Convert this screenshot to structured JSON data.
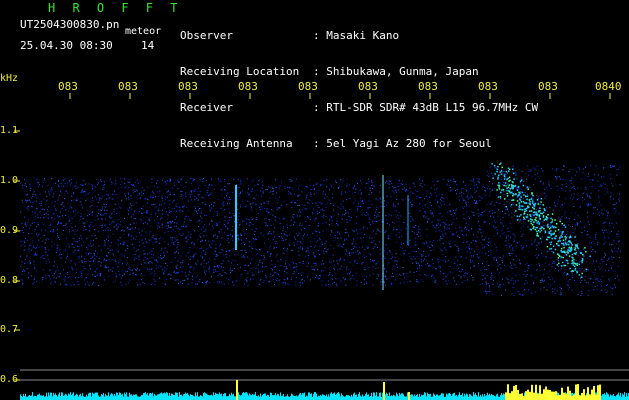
{
  "header": {
    "title": "H R O F F T",
    "filename": "UT2504300830.pn",
    "meteor_label": "meteor",
    "datetime": "25.04.30 08:30",
    "count": "14"
  },
  "info": [
    {
      "key": "Observer",
      "value": ": Masaki Kano"
    },
    {
      "key": "Receiving Location",
      "value": ": Shibukawa, Gunma, Japan"
    },
    {
      "key": "Receiver",
      "value": ": RTL-SDR SDR# 43dB L15 96.7MHz CW"
    },
    {
      "key": "Receiving Antenna",
      "value": ": 5el Yagi Az 280 for Seoul"
    }
  ],
  "axes": {
    "y_unit": "kHz",
    "y_ticks": [
      "1.1",
      "1.0",
      "0.9",
      "0.8",
      "0.7",
      "0.6"
    ],
    "x_ticks": [
      "083",
      "083",
      "083",
      "083",
      "083",
      "083",
      "083",
      "083",
      "083",
      "0840"
    ]
  },
  "colors": {
    "header_green": "#35e52f",
    "label_yellow": "#f0ee3c",
    "signal_cyan": "#00e5ff",
    "noise_blue": "#1a3cff",
    "grid_gray": "#8a8a8a"
  }
}
